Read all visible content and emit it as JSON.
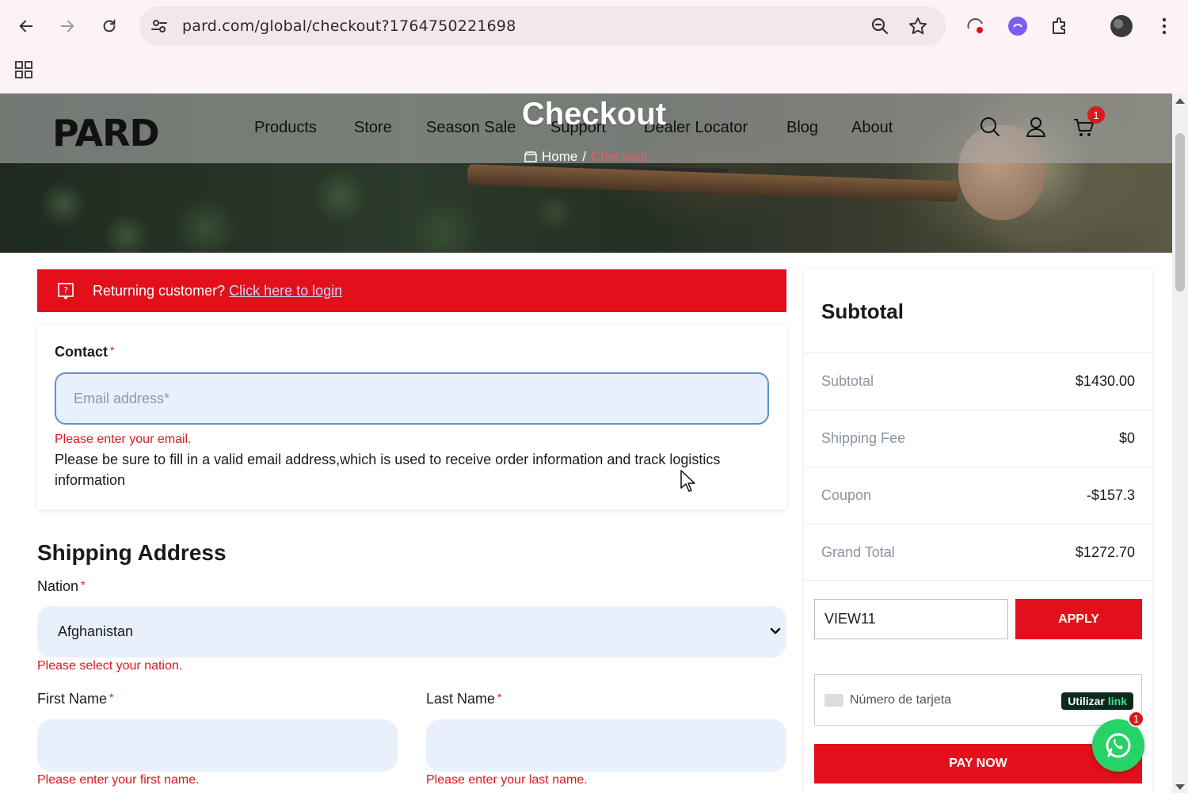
{
  "browser": {
    "url": "pard.com/global/checkout?1764750221698"
  },
  "header": {
    "logo": "PARD",
    "menu": [
      "Products",
      "Store",
      "Season Sale",
      "Support",
      "Dealer Locator",
      "Blog",
      "About"
    ],
    "page_title": "Checkout",
    "breadcrumb": {
      "home": "Home",
      "sep": "/",
      "current": "Checkout"
    },
    "cart_count": "1"
  },
  "banner": {
    "text": "Returning customer?",
    "link": "Click here to login"
  },
  "contact": {
    "label": "Contact",
    "required_mark": "*",
    "email_placeholder": "Email address*",
    "email_value": "",
    "error": "Please enter your email.",
    "help": "Please be sure to fill in a valid email address,which is used to receive order information and track logistics information"
  },
  "shipping": {
    "title": "Shipping Address",
    "nation_label": "Nation",
    "nation_value": "Afghanistan",
    "nation_error": "Please select your nation.",
    "first_name_label": "First Name",
    "first_name_error": "Please enter your first name.",
    "last_name_label": "Last Name",
    "last_name_error": "Please enter your last name."
  },
  "summary": {
    "title": "Subtotal",
    "rows": [
      {
        "label": "Subtotal",
        "value": "$1430.00"
      },
      {
        "label": "Shipping Fee",
        "value": "$0"
      },
      {
        "label": "Coupon",
        "value": "-$157.3"
      },
      {
        "label": "Grand Total",
        "value": "$1272.70"
      }
    ],
    "coupon_code": "VIEW11",
    "apply_label": "APPLY",
    "card_placeholder": "Número de tarjeta",
    "link_pill": {
      "prefix": "Utilizar",
      "brand": "link"
    },
    "pay_label": "PAY NOW"
  },
  "whatsapp_badge": "1",
  "colors": {
    "brand_red": "#e3101b",
    "input_bg": "#e8f0fc",
    "error_red": "#d71920"
  }
}
